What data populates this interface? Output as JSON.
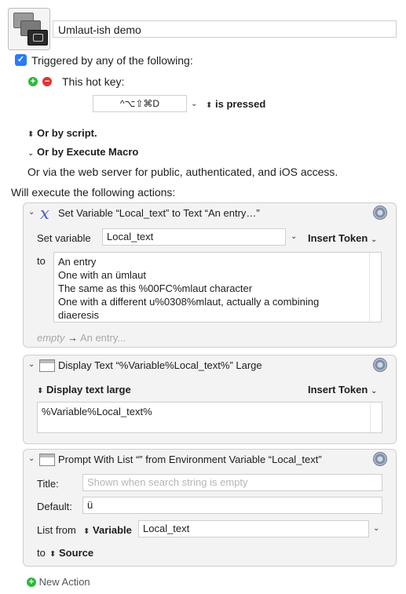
{
  "macro": {
    "name": "Umlaut-ish demo"
  },
  "triggers": {
    "heading": "Triggered by any of the following:",
    "hotkey_label": "This hot key:",
    "hotkey_value": "^⌥⇧⌘D",
    "hotkey_state": "is pressed",
    "or_script": "Or by script.",
    "or_execute_macro": "Or by Execute Macro",
    "web_server": "Or via the web server for public, authenticated, and iOS access."
  },
  "actions_heading": "Will execute the following actions:",
  "action1": {
    "title": "Set Variable “Local_text” to Text “An entry…”",
    "set_variable_label": "Set variable",
    "variable": "Local_text",
    "insert_token": "Insert Token",
    "to_label": "to",
    "text_lines": [
      "An entry",
      "One with an ümlaut",
      "The same as this %00FC%mlaut character",
      "One with a different u%0308%mlaut, actually a combining",
      "diaeresis"
    ],
    "preview_empty": "empty",
    "preview_arrow": "→",
    "preview_text": "An entry..."
  },
  "action2": {
    "title": "Display Text “%Variable%Local_text%” Large",
    "mode": "Display text large",
    "insert_token": "Insert Token",
    "text": "%Variable%Local_text%"
  },
  "action3": {
    "title": "Prompt With List “” from Environment Variable “Local_text”",
    "title_label": "Title:",
    "title_placeholder": "Shown when search string is empty",
    "default_label": "Default:",
    "default_value": "ü",
    "list_from_label": "List from",
    "list_from_type": "Variable",
    "list_from_value": "Local_text",
    "to_label": "to",
    "to_value": "Source"
  },
  "new_action": "New Action"
}
